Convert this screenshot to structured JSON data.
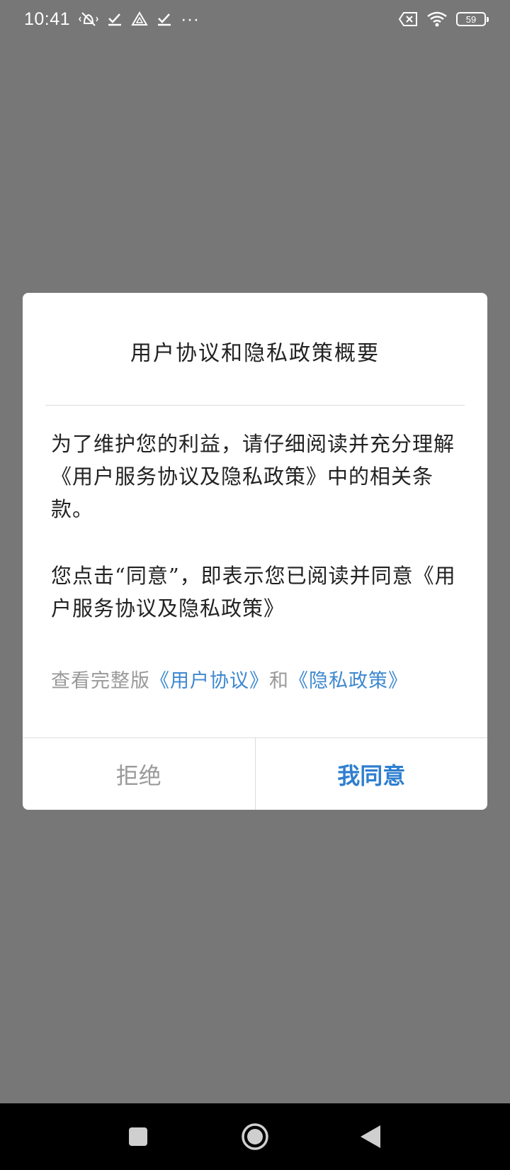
{
  "status_bar": {
    "time": "10:41",
    "more": "···",
    "battery": "59"
  },
  "dialog": {
    "title": "用户协议和隐私政策概要",
    "paragraph_1": "为了维护您的利益，请仔细阅读并充分理解《用户服务协议及隐私政策》中的相关条款。",
    "paragraph_2": "您点击“同意”，即表示您已阅读并同意《用户服务协议及隐私政策》",
    "links": {
      "prefix": "查看完整版",
      "user_agreement": "《用户协议》",
      "conjunction": "和",
      "privacy_policy": "《隐私政策》"
    },
    "reject_label": "拒绝",
    "agree_label": "我同意"
  },
  "colors": {
    "overlay": "#777777",
    "link": "#3d88d0",
    "agree": "#2f7fcf",
    "muted": "#999999"
  },
  "nav_bar": {
    "icons": [
      "recents-icon",
      "home-icon",
      "back-icon"
    ]
  }
}
